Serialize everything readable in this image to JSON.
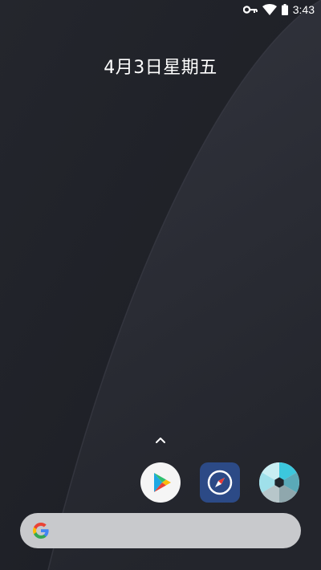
{
  "status_bar": {
    "time": "3:43",
    "icons": [
      "vpn-key-icon",
      "wifi-icon",
      "battery-icon"
    ]
  },
  "date_widget": {
    "text": "4月3日星期五"
  },
  "drawer_handle": {
    "icon": "chevron-up-icon"
  },
  "dock": {
    "apps": [
      {
        "icon": "play-store-icon"
      },
      {
        "icon": "compass-browser-icon"
      },
      {
        "icon": "camera-aperture-icon"
      }
    ]
  },
  "search_bar": {
    "icon": "google-g-icon",
    "value": ""
  },
  "colors": {
    "background": "#1d1f26",
    "wallpaper_curve": "#2b2d35",
    "search_bar": "#c8c9cc",
    "browser_icon_bg": "#2c4a86",
    "camera_accent": "#3cc7dd"
  }
}
